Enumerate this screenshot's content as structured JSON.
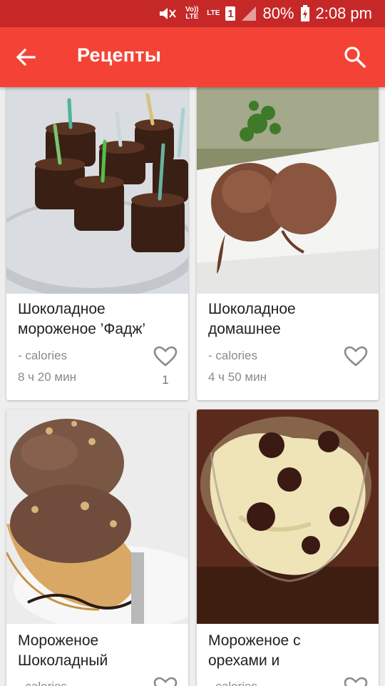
{
  "status_bar": {
    "lte_label": "Vo)) LTE",
    "lte2_label": "LTE",
    "sim_number": "1",
    "battery": "80%",
    "time": "2:08 pm"
  },
  "app_bar": {
    "title": "Рецепты",
    "back_icon": "arrow-left-icon",
    "search_icon": "search-icon"
  },
  "recipes": [
    {
      "name_line1": "Шоколадное",
      "name_line2": "мороженое ’Фадж’",
      "calories": "- calories",
      "time": "8 ч 20 мин",
      "likes": "1"
    },
    {
      "name_line1": "Шоколадное",
      "name_line2": "домашнее",
      "calories": "- calories",
      "time": "4 ч 50 мин",
      "likes": ""
    },
    {
      "name_line1": "Мороженое",
      "name_line2": "Шоколадный",
      "calories": "- calories",
      "time": "",
      "likes": ""
    },
    {
      "name_line1": "Мороженое с",
      "name_line2": "орехами и",
      "calories": "- calories",
      "time": "",
      "likes": ""
    }
  ],
  "colors": {
    "app_bar": "#f44336",
    "status_bar": "#c62828",
    "background": "#eeeeee"
  }
}
